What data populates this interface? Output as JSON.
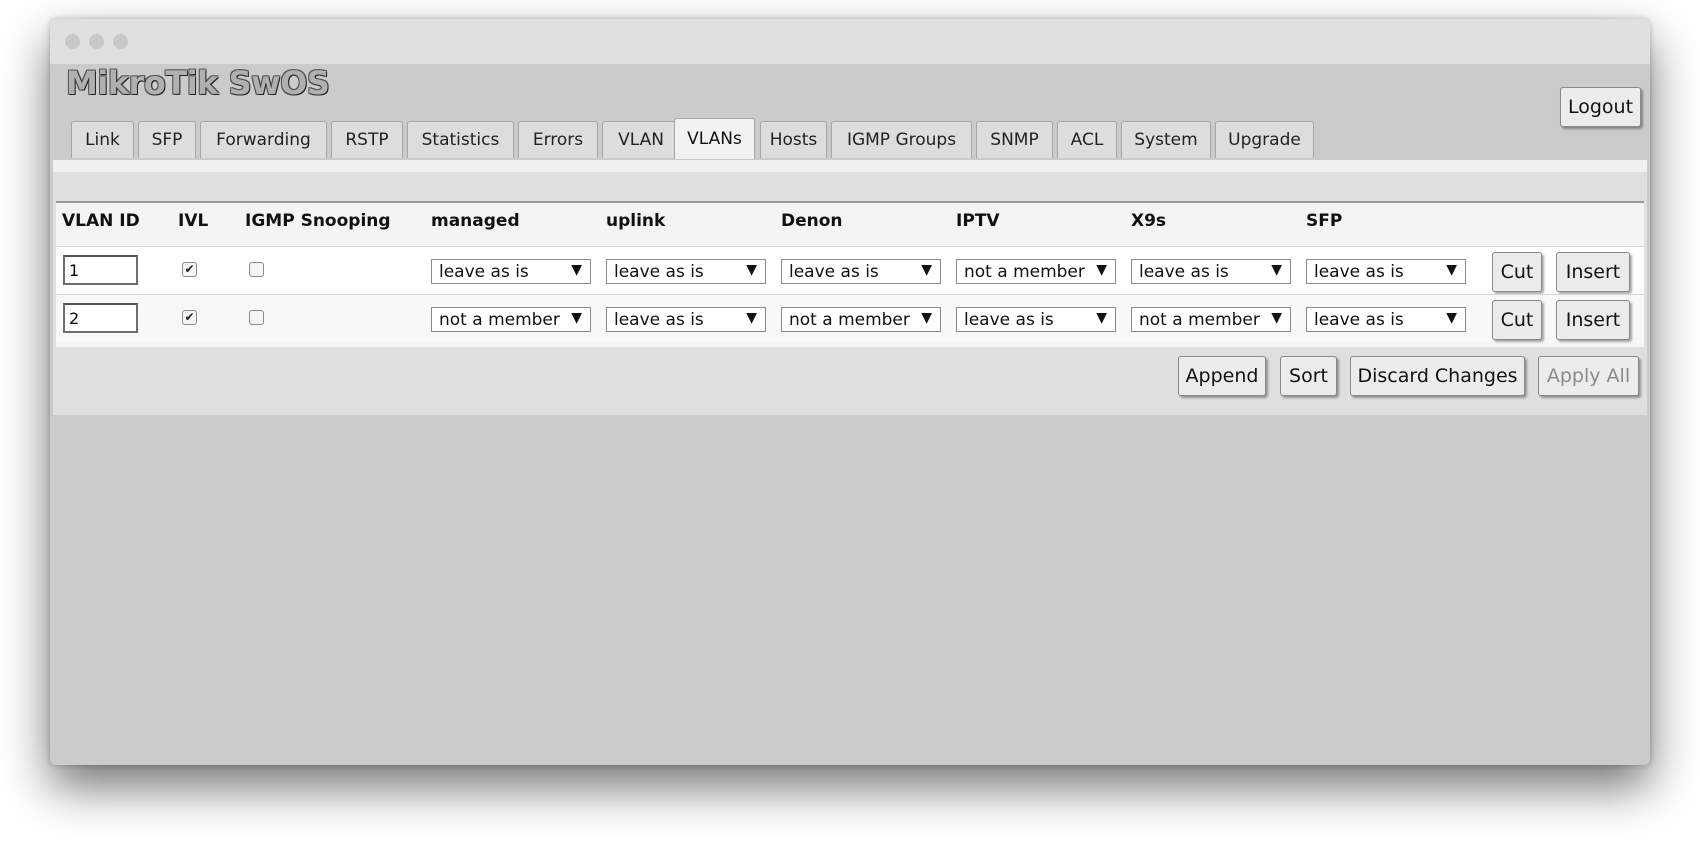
{
  "app": {
    "title": "MikroTik SwOS",
    "logout_label": "Logout"
  },
  "tabs": [
    {
      "label": "Link"
    },
    {
      "label": "SFP"
    },
    {
      "label": "Forwarding"
    },
    {
      "label": "RSTP"
    },
    {
      "label": "Statistics"
    },
    {
      "label": "Errors"
    },
    {
      "label": "VLAN"
    },
    {
      "label": "VLANs",
      "active": true
    },
    {
      "label": "Hosts"
    },
    {
      "label": "IGMP Groups"
    },
    {
      "label": "SNMP"
    },
    {
      "label": "ACL"
    },
    {
      "label": "System"
    },
    {
      "label": "Upgrade"
    }
  ],
  "table": {
    "headers": [
      "VLAN ID",
      "IVL",
      "IGMP Snooping",
      "managed",
      "uplink",
      "Denon",
      "IPTV",
      "X9s",
      "SFP"
    ],
    "rows": [
      {
        "vlan_id": "1",
        "ivl": true,
        "igmp_snooping": false,
        "ports": [
          "leave as is",
          "leave as is",
          "leave as is",
          "not a member",
          "leave as is",
          "leave as is"
        ],
        "cut_label": "Cut",
        "insert_label": "Insert"
      },
      {
        "vlan_id": "2",
        "ivl": true,
        "igmp_snooping": false,
        "ports": [
          "not a member",
          "leave as is",
          "not a member",
          "leave as is",
          "not a member",
          "leave as is"
        ],
        "cut_label": "Cut",
        "insert_label": "Insert"
      }
    ]
  },
  "actions": {
    "append_label": "Append",
    "sort_label": "Sort",
    "discard_label": "Discard Changes",
    "apply_label": "Apply All",
    "apply_enabled": false
  },
  "icons": {
    "checkbox_checked": "check-icon",
    "dropdown": "dropdown-caret-icon"
  }
}
